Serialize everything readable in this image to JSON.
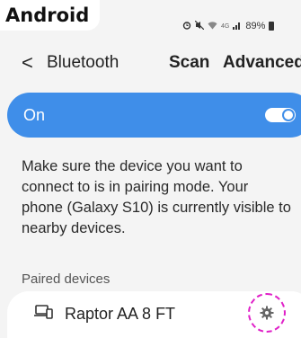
{
  "status_bar": {
    "brand": "Android",
    "signal_text": "4G",
    "battery": "89%",
    "icons": [
      "alarm-icon",
      "mute-icon",
      "wifi-icon",
      "lte-icon",
      "signal-icon",
      "battery-icon"
    ]
  },
  "header": {
    "back_glyph": "<",
    "title": "Bluetooth",
    "scan": "Scan",
    "advanced": "Advanced"
  },
  "toggle_row": {
    "label": "On",
    "state": "on",
    "color": "#3f8ee9"
  },
  "description": "Make sure the device you want to connect to is in pairing mode. Your phone (Galaxy S10) is currently visible to nearby devices.",
  "paired": {
    "title": "Paired devices",
    "devices": [
      {
        "name": "Raptor AA 8 FT",
        "icon": "laptop-phone-icon",
        "settings_icon": "gear-icon"
      }
    ]
  },
  "highlight_color": "#e020c8"
}
